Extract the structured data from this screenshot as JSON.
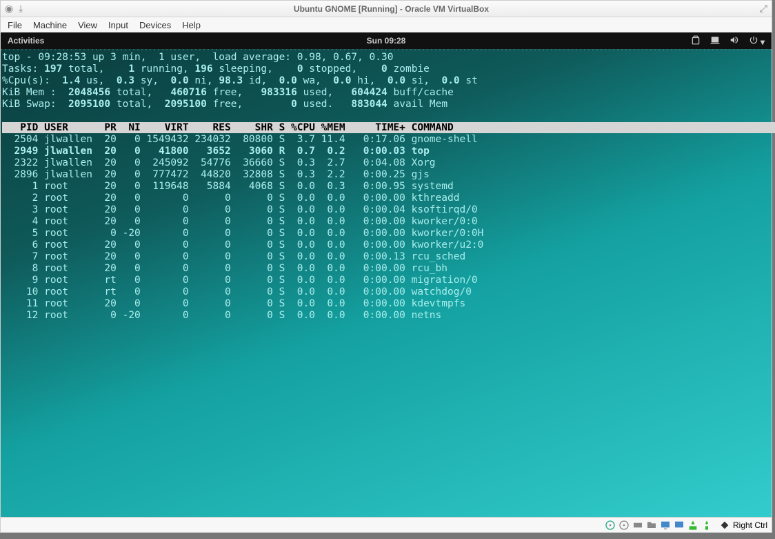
{
  "window": {
    "title": "Ubuntu GNOME [Running] - Oracle VM VirtualBox",
    "menu": [
      "File",
      "Machine",
      "View",
      "Input",
      "Devices",
      "Help"
    ]
  },
  "gnome": {
    "activities": "Activities",
    "clock": "Sun 09:28"
  },
  "top_summary": {
    "line1a": "top - 09:28:53 up 3 min,  1 user,  load average: 0.98, 0.67, 0.30",
    "line2_tasks_l": "Tasks:",
    "line2_total": " 197 ",
    "line2_total_l": "total,",
    "line2_run": "    1 ",
    "line2_run_l": "running,",
    "line2_sleep": " 196 ",
    "line2_sleep_l": "sleeping,",
    "line2_stop": "    0 ",
    "line2_stop_l": "stopped,",
    "line2_zom": "    0 ",
    "line2_zom_l": "zombie",
    "line3_l": "%Cpu(s):",
    "line3_us": "  1.4 ",
    "line3_us_l": "us,",
    "line3_sy": "  0.3 ",
    "line3_sy_l": "sy,",
    "line3_ni": "  0.0 ",
    "line3_ni_l": "ni,",
    "line3_id": " 98.3 ",
    "line3_id_l": "id,",
    "line3_wa": "  0.0 ",
    "line3_wa_l": "wa,",
    "line3_hi": "  0.0 ",
    "line3_hi_l": "hi,",
    "line3_si": "  0.0 ",
    "line3_si_l": "si,",
    "line3_st": "  0.0 ",
    "line3_st_l": "st",
    "line4_l": "KiB Mem :",
    "line4_total": "  2048456 ",
    "line4_total_l": "total,",
    "line4_free": "   460716 ",
    "line4_free_l": "free,",
    "line4_used": "   983316 ",
    "line4_used_l": "used,",
    "line4_buff": "   604424 ",
    "line4_buff_l": "buff/cache",
    "line5_l": "KiB Swap:",
    "line5_total": "  2095100 ",
    "line5_total_l": "total,",
    "line5_free": "  2095100 ",
    "line5_free_l": "free,",
    "line5_used": "        0 ",
    "line5_used_l": "used.",
    "line5_avail": "   883044 ",
    "line5_avail_l": "avail Mem"
  },
  "columns": "   PID USER      PR  NI    VIRT    RES    SHR S %CPU %MEM     TIME+ COMMAND                                                                     ",
  "processes": [
    {
      "row": "  2504 jlwallen  20   0 1549432 234032  80800 S  3.7 11.4   0:17.06 gnome-shell"
    },
    {
      "row": "  2949 jlwallen  20   0   41800   3652   3060 R  0.7  0.2   0:00.03 top",
      "selected": true
    },
    {
      "row": "  2322 jlwallen  20   0  245092  54776  36660 S  0.3  2.7   0:04.08 Xorg"
    },
    {
      "row": "  2896 jlwallen  20   0  777472  44820  32808 S  0.3  2.2   0:00.25 gjs"
    },
    {
      "row": "     1 root      20   0  119648   5884   4068 S  0.0  0.3   0:00.95 systemd"
    },
    {
      "row": "     2 root      20   0       0      0      0 S  0.0  0.0   0:00.00 kthreadd"
    },
    {
      "row": "     3 root      20   0       0      0      0 S  0.0  0.0   0:00.04 ksoftirqd/0"
    },
    {
      "row": "     4 root      20   0       0      0      0 S  0.0  0.0   0:00.00 kworker/0:0"
    },
    {
      "row": "     5 root       0 -20       0      0      0 S  0.0  0.0   0:00.00 kworker/0:0H"
    },
    {
      "row": "     6 root      20   0       0      0      0 S  0.0  0.0   0:00.00 kworker/u2:0"
    },
    {
      "row": "     7 root      20   0       0      0      0 S  0.0  0.0   0:00.13 rcu_sched"
    },
    {
      "row": "     8 root      20   0       0      0      0 S  0.0  0.0   0:00.00 rcu_bh"
    },
    {
      "row": "     9 root      rt   0       0      0      0 S  0.0  0.0   0:00.00 migration/0"
    },
    {
      "row": "    10 root      rt   0       0      0      0 S  0.0  0.0   0:00.00 watchdog/0"
    },
    {
      "row": "    11 root      20   0       0      0      0 S  0.0  0.0   0:00.00 kdevtmpfs"
    },
    {
      "row": "    12 root       0 -20       0      0      0 S  0.0  0.0   0:00.00 netns"
    }
  ],
  "status": {
    "right_ctrl": "Right Ctrl"
  }
}
